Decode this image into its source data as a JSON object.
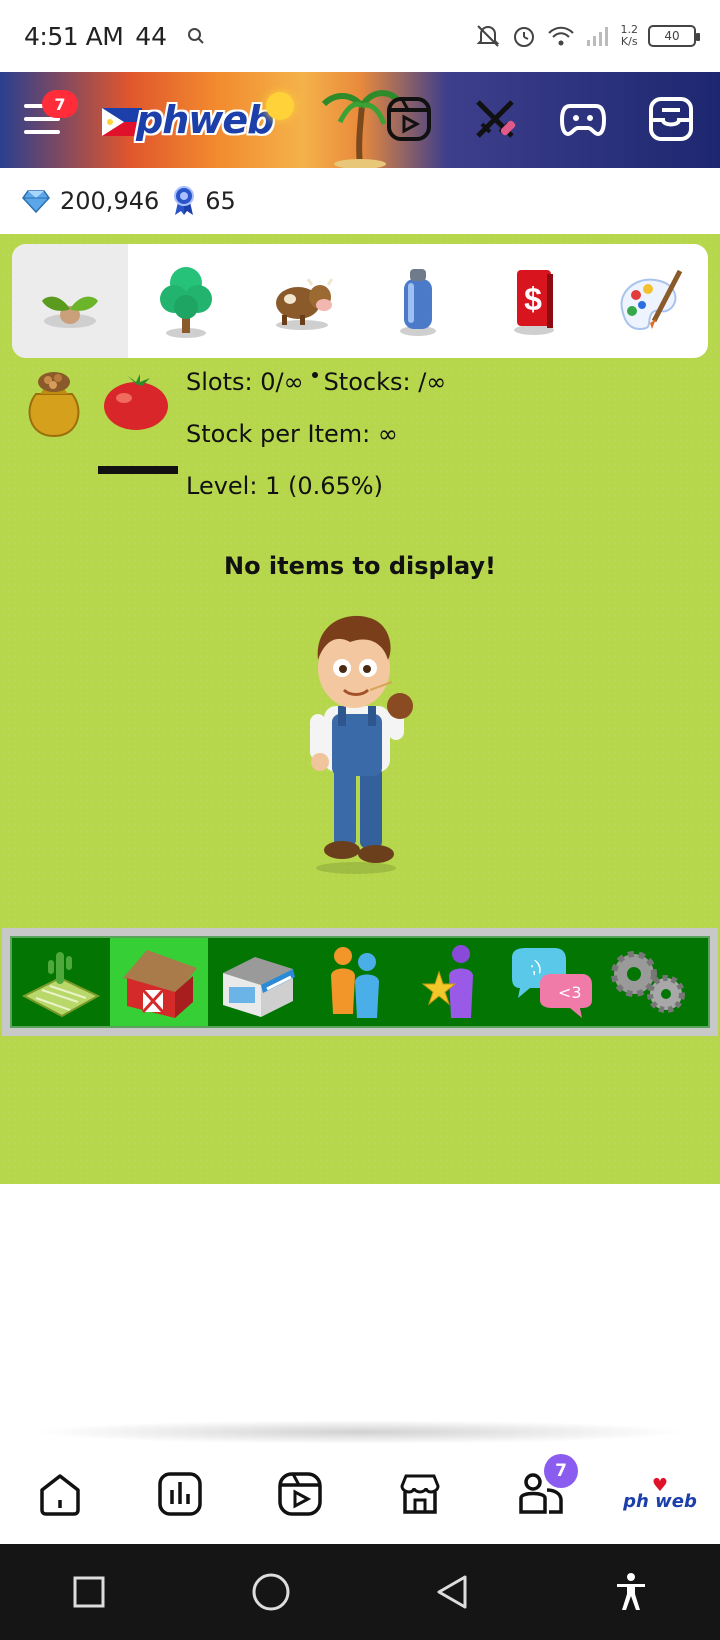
{
  "status_bar": {
    "time": "4:51 AM",
    "extra": "44",
    "net_speed_value": "1.2",
    "net_speed_unit": "K/s",
    "battery": "40"
  },
  "header": {
    "menu_badge": "7",
    "logo_text": "phweb",
    "icons": [
      "reels-icon",
      "swords-icon",
      "game-controller-icon",
      "inbox-icon"
    ]
  },
  "currency": {
    "diamonds": "200,946",
    "ribbons": "65"
  },
  "categories": {
    "tabs": [
      {
        "name": "seeds",
        "icon": "sprout-icon",
        "active": true
      },
      {
        "name": "trees",
        "icon": "tree-icon"
      },
      {
        "name": "animals",
        "icon": "cow-icon"
      },
      {
        "name": "supplies",
        "icon": "canister-icon"
      },
      {
        "name": "cash",
        "icon": "dollar-card-icon"
      },
      {
        "name": "decorations",
        "icon": "paint-palette-icon"
      }
    ]
  },
  "storage": {
    "slots_text": "Slots: 0/∞",
    "stocks_text": "Stocks: /∞",
    "stock_per_item_text": "Stock per Item: ∞",
    "level_text": "Level: 1 (0.65%)",
    "empty_message": "No items to display!"
  },
  "game_menu": {
    "items": [
      {
        "name": "farm",
        "icon": "farm-field-icon"
      },
      {
        "name": "barn",
        "icon": "barn-icon",
        "active": true
      },
      {
        "name": "market",
        "icon": "shop-icon"
      },
      {
        "name": "neighbors",
        "icon": "people-icon"
      },
      {
        "name": "achievements",
        "icon": "star-person-icon"
      },
      {
        "name": "chat",
        "icon": "chat-bubbles-icon"
      },
      {
        "name": "settings",
        "icon": "gears-icon"
      }
    ]
  },
  "bottom_nav": {
    "items": [
      "home",
      "stats",
      "reels",
      "shop",
      "friends",
      "phweb"
    ],
    "friends_badge": "7",
    "mini_logo": "ph web"
  },
  "colors": {
    "game_bg": "#b6d64c",
    "menu_green": "#027502",
    "menu_active": "#36cf36",
    "badge_red": "#ff2d3a",
    "badge_purple": "#8a5cf0"
  }
}
